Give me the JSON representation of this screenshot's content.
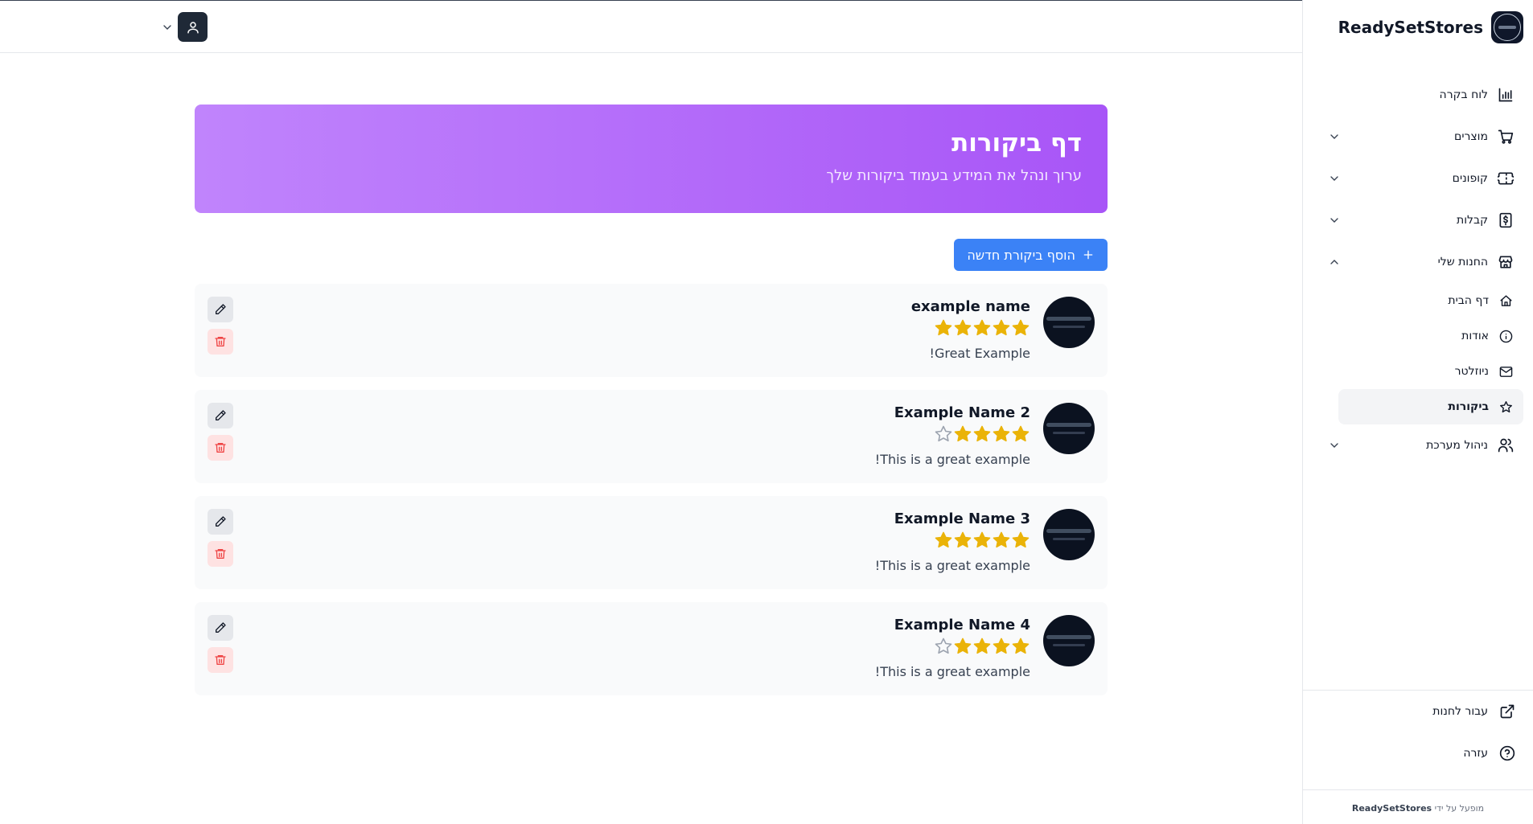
{
  "brand": {
    "name": "ReadySetStores"
  },
  "sidebar": {
    "items": [
      {
        "label": "לוח בקרה",
        "icon": "bar-chart-icon"
      },
      {
        "label": "מוצרים",
        "icon": "cart-icon"
      },
      {
        "label": "קופונים",
        "icon": "ticket-icon"
      },
      {
        "label": "קבלות",
        "icon": "receipt-icon"
      },
      {
        "label": "החנות שלי",
        "icon": "store-icon"
      },
      {
        "label": "ניהול מערכת",
        "icon": "users-icon"
      }
    ],
    "store_sub": [
      {
        "label": "דף הבית",
        "icon": "home-icon"
      },
      {
        "label": "אודות",
        "icon": "info-icon"
      },
      {
        "label": "ניוזלטר",
        "icon": "mail-icon"
      },
      {
        "label": "ביקורות",
        "icon": "star-icon"
      }
    ],
    "bottom": [
      {
        "label": "עבור לחנות",
        "icon": "external-link-icon"
      },
      {
        "label": "עזרה",
        "icon": "help-icon"
      }
    ],
    "powered_prefix": "מופעל על ידי",
    "powered_brand": "ReadySetStores"
  },
  "page": {
    "title": "דף ביקורות",
    "subtitle": "ערוך ונהל את המידע בעמוד ביקורות שלך",
    "add_button": "הוסף ביקורת חדשה"
  },
  "reviews": [
    {
      "name": "example name",
      "rating": 5,
      "text": "Great Example!"
    },
    {
      "name": "Example Name 2",
      "rating": 4,
      "text": "This is a great example!"
    },
    {
      "name": "Example Name 3",
      "rating": 5,
      "text": "This is a great example!"
    },
    {
      "name": "Example Name 4",
      "rating": 4,
      "text": "This is a great example!"
    }
  ],
  "colors": {
    "accent": "#3b82f6",
    "hero_from": "#c084fc",
    "hero_to": "#a855f7",
    "star": "#eab308",
    "delete": "#ef4444"
  }
}
